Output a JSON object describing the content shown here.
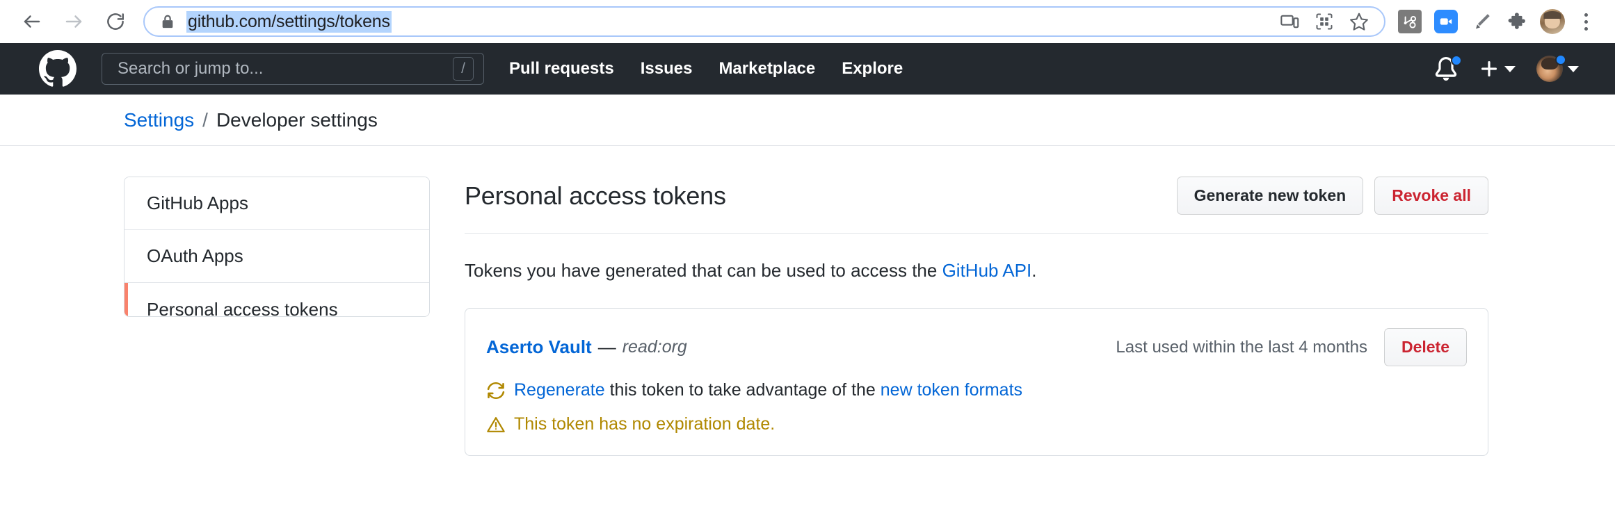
{
  "browser": {
    "back_icon": "arrow-left-icon",
    "forward_icon": "arrow-right-icon",
    "reload_icon": "reload-icon",
    "lock_icon": "lock-icon",
    "url": "github.com/settings/tokens",
    "url_selected": true,
    "omnibox_icons": [
      "cast-device-icon",
      "qr-code-icon",
      "bookmark-star-icon"
    ],
    "extensions": [
      "hubspot-icon",
      "zoom-icon",
      "pencil-icon",
      "puzzle-extensions-icon"
    ],
    "profile_icon": "chrome-profile-avatar",
    "menu_icon": "three-dot-menu-icon"
  },
  "gh_header": {
    "logo": "github-logo-icon",
    "search_placeholder": "Search or jump to...",
    "search_shortcut": "/",
    "nav": [
      {
        "label": "Pull requests"
      },
      {
        "label": "Issues"
      },
      {
        "label": "Marketplace"
      },
      {
        "label": "Explore"
      }
    ],
    "notifications_icon": "bell-icon",
    "create_new_icon": "plus-icon",
    "avatar_icon": "user-avatar",
    "notification_dot_color": "#2188ff"
  },
  "breadcrumb": {
    "parent": "Settings",
    "separator": "/",
    "current": "Developer settings"
  },
  "sidebar": {
    "items": [
      {
        "label": "GitHub Apps",
        "active": false
      },
      {
        "label": "OAuth Apps",
        "active": false
      },
      {
        "label": "Personal access tokens",
        "active": true
      }
    ],
    "active_marker_color": "#f9826c"
  },
  "main": {
    "title": "Personal access tokens",
    "generate_label": "Generate new token",
    "revoke_label": "Revoke all",
    "description_pre": "Tokens you have generated that can be used to access the ",
    "description_link": "GitHub API",
    "description_post": ".",
    "tokens": [
      {
        "name": "Aserto Vault",
        "dash": "—",
        "scope": "read:org",
        "last_used": "Last used within the last 4 months",
        "delete_label": "Delete",
        "regenerate_icon": "sync-circle-icon",
        "regenerate_link": "Regenerate",
        "regenerate_mid": " this token to take advantage of the ",
        "regenerate_link2": "new token formats",
        "warning_icon": "alert-triangle-icon",
        "warning_text": "This token has no expiration date."
      }
    ]
  },
  "colors": {
    "link": "#0366d6",
    "danger": "#cb2431",
    "warning": "#b08800",
    "header_bg": "#24292f"
  }
}
